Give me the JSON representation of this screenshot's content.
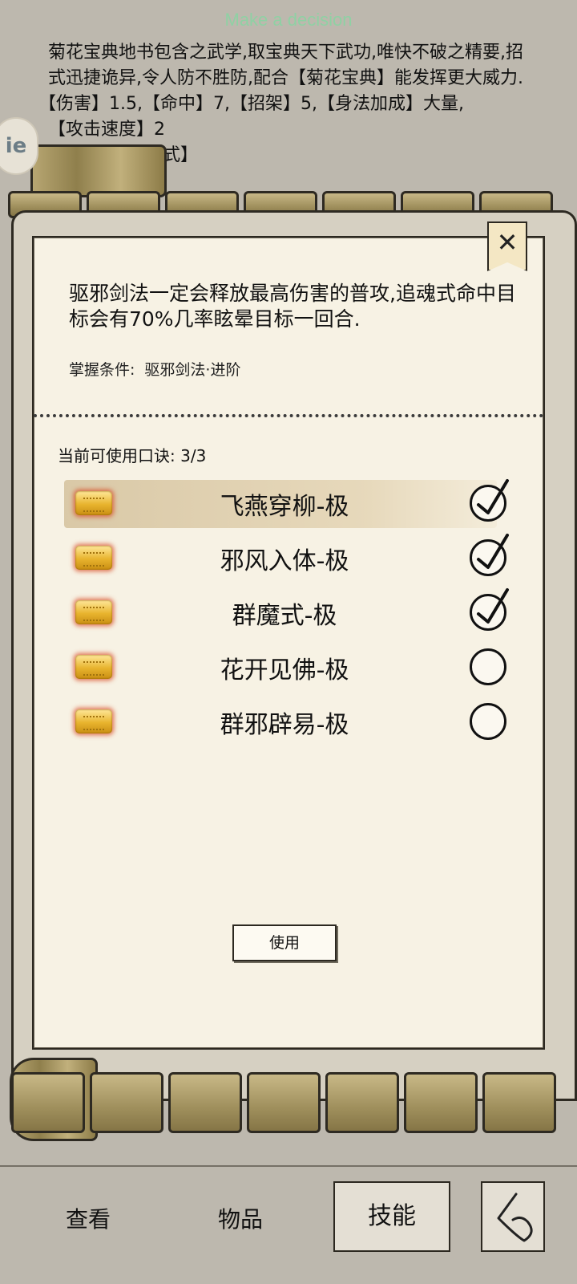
{
  "banner": "Make a decision",
  "background": {
    "line1": "菊花宝典地书包含之武学,取宝典天下武功,唯快不破之精要,招式迅捷诡异,令人防不胜防,配合【菊花宝典】能发挥更大威力.",
    "line2": "【伤害】1.5,【命中】7,【招架】5,【身法加成】大量,",
    "line3": "【攻击速度】2",
    "line4": "【诀式】【群魔式】",
    "badge": "ie"
  },
  "modal": {
    "close_label": "✕",
    "description": "驱邪剑法一定会释放最高伤害的普攻,追魂式命中目标会有70%几率眩晕目标一回合.",
    "condition_label": "掌握条件:",
    "condition_value": "驱邪剑法·进阶",
    "count_label": "当前可使用口诀:",
    "count_value": "3/3",
    "skills": [
      {
        "name": "飞燕穿柳-极",
        "checked": true
      },
      {
        "name": "邪风入体-极",
        "checked": true
      },
      {
        "name": "群魔式-极",
        "checked": true
      },
      {
        "name": "花开见佛-极",
        "checked": false
      },
      {
        "name": "群邪辟易-极",
        "checked": false
      }
    ],
    "use_button": "使用"
  },
  "nav": {
    "view": "查看",
    "items": "物品",
    "skills": "技能"
  }
}
